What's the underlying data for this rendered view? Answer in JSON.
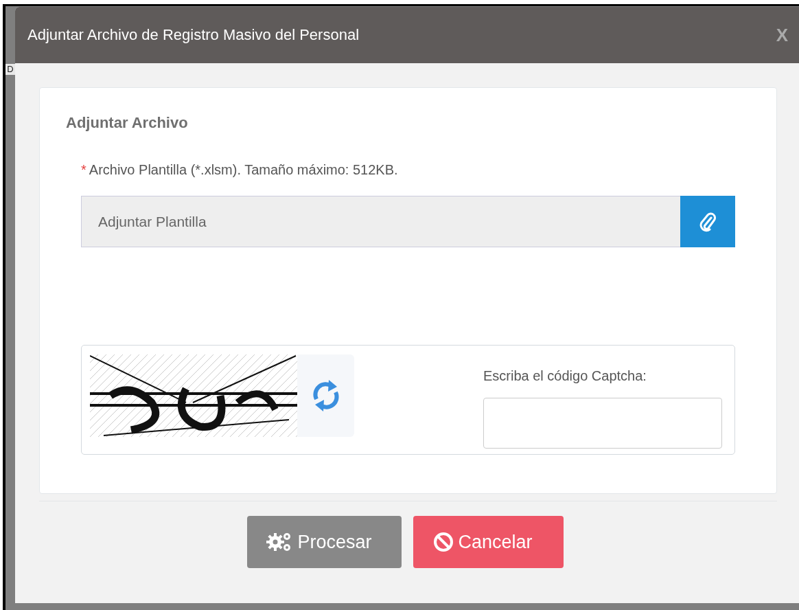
{
  "background_fragment": "D",
  "dialog": {
    "title": "Adjuntar Archivo de Registro Masivo del Personal",
    "close": "X"
  },
  "section": {
    "title": "Adjuntar Archivo",
    "required_mark": "*",
    "file_label": "Archivo Plantilla (*.xlsm). Tamaño máximo: 512KB.",
    "file_placeholder": "Adjuntar Plantilla"
  },
  "captcha": {
    "kind": "picture",
    "label": "Escriba el código Captcha:"
  },
  "buttons": [
    {
      "label": "Procesar",
      "kind": "process"
    },
    {
      "label": "Cancelar",
      "kind": "cancel"
    }
  ]
}
